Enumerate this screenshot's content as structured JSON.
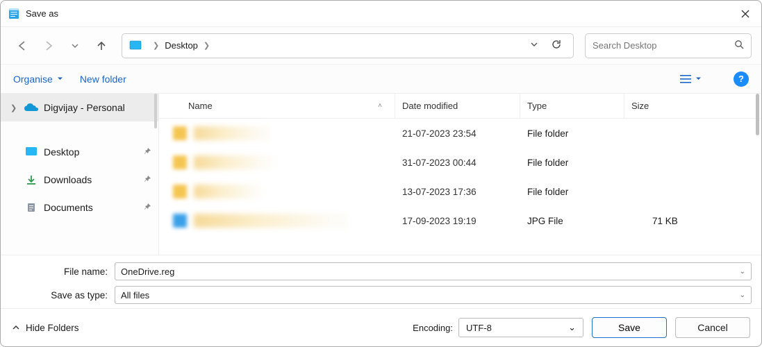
{
  "title": "Save as",
  "breadcrumb": {
    "current": "Desktop"
  },
  "search": {
    "placeholder": "Search Desktop"
  },
  "toolbar": {
    "organise": "Organise",
    "new_folder": "New folder"
  },
  "sidebar": {
    "onedrive_label": "Digvijay - Personal",
    "desktop": "Desktop",
    "downloads": "Downloads",
    "documents": "Documents"
  },
  "columns": {
    "name": "Name",
    "date": "Date modified",
    "type": "Type",
    "size": "Size"
  },
  "rows": [
    {
      "date": "21-07-2023 23:54",
      "type": "File folder",
      "size": ""
    },
    {
      "date": "31-07-2023 00:44",
      "type": "File folder",
      "size": ""
    },
    {
      "date": "13-07-2023 17:36",
      "type": "File folder",
      "size": ""
    },
    {
      "date": "17-09-2023 19:19",
      "type": "JPG File",
      "size": "71 KB"
    }
  ],
  "form": {
    "file_name_label": "File name:",
    "file_name_value": "OneDrive.reg",
    "save_type_label": "Save as type:",
    "save_type_value": "All files"
  },
  "footer": {
    "hide_folders": "Hide Folders",
    "encoding_label": "Encoding:",
    "encoding_value": "UTF-8",
    "save": "Save",
    "cancel": "Cancel"
  }
}
